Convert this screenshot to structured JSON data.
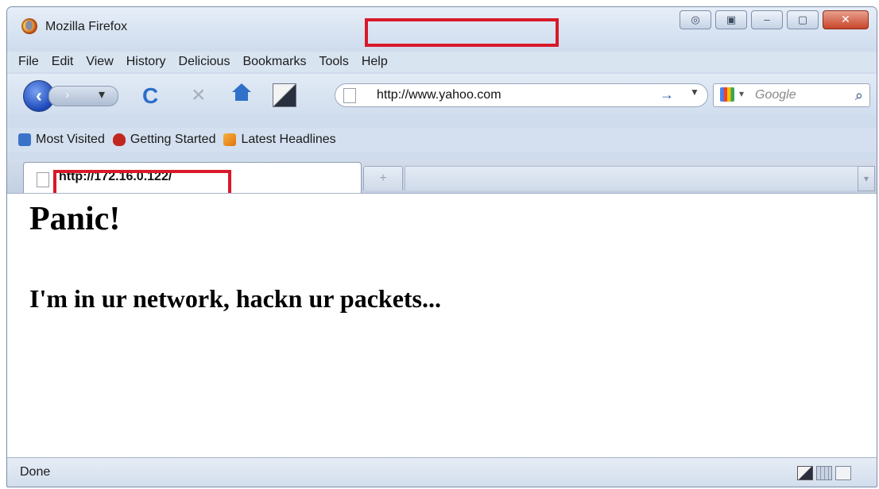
{
  "window": {
    "title": "Mozilla Firefox"
  },
  "menubar": {
    "items": [
      "File",
      "Edit",
      "View",
      "History",
      "Delicious",
      "Bookmarks",
      "Tools",
      "Help"
    ]
  },
  "navbar": {
    "url": "http://www.yahoo.com",
    "search_placeholder": "Google"
  },
  "bookmarks": {
    "items": [
      "Most Visited",
      "Getting Started",
      "Latest Headlines"
    ]
  },
  "tab": {
    "title": "http://172.16.0.122/",
    "new_tab_glyph": "+"
  },
  "content": {
    "heading": "Panic!",
    "subheading": "I'm in ur network, hackn ur packets..."
  },
  "status": {
    "text": "Done"
  },
  "colors": {
    "highlight_box": "#d8192a",
    "chrome": "#cfdced"
  }
}
